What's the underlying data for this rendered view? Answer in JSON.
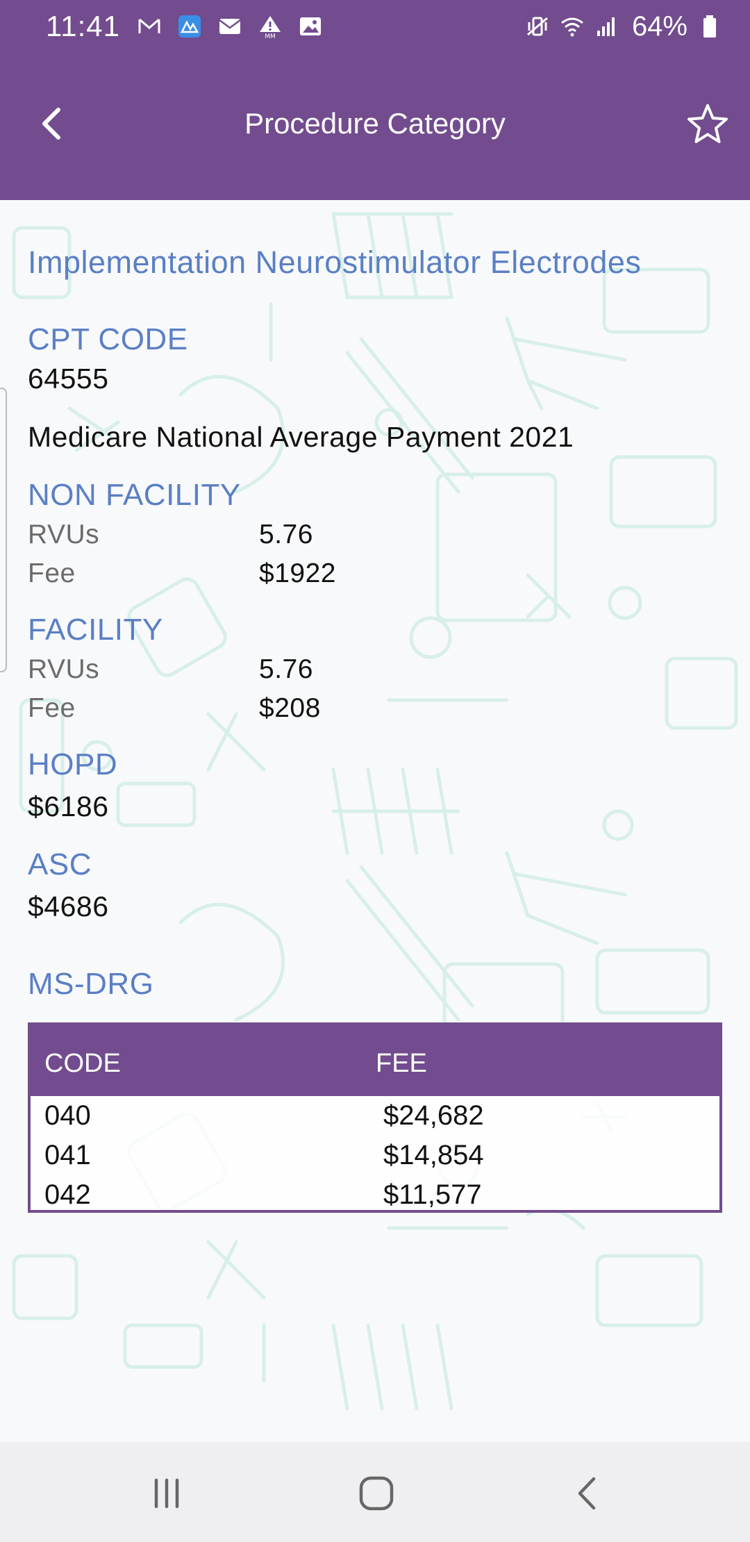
{
  "status_bar": {
    "time": "11:41",
    "battery": "64%",
    "icons_left": [
      "gmail-icon",
      "app-icon",
      "mail-icon",
      "warning-icon",
      "image-icon"
    ],
    "icons_right": [
      "vibrate-icon",
      "wifi-icon",
      "signal-icon",
      "battery-icon"
    ]
  },
  "app_bar": {
    "title": "Procedure Category",
    "background": "#724c8e"
  },
  "procedure": {
    "name": "Implementation Neurostimulator Electrodes",
    "cpt_label": "CPT CODE",
    "cpt_code": "64555",
    "payment_title": "Medicare National Average Payment 2021",
    "non_facility": {
      "label": "NON FACILITY",
      "rvus_label": "RVUs",
      "rvus_value": "5.76",
      "fee_label": "Fee",
      "fee_value": "$1922"
    },
    "facility": {
      "label": "FACILITY",
      "rvus_label": "RVUs",
      "rvus_value": "5.76",
      "fee_label": "Fee",
      "fee_value": "$208"
    },
    "hopd": {
      "label": "HOPD",
      "value": "$6186"
    },
    "asc": {
      "label": "ASC",
      "value": "$4686"
    },
    "ms_drg": {
      "label": "MS-DRG",
      "columns": [
        "CODE",
        "FEE"
      ],
      "rows": [
        {
          "code": "040",
          "fee": "$24,682"
        },
        {
          "code": "041",
          "fee": "$14,854"
        },
        {
          "code": "042",
          "fee": "$11,577"
        }
      ]
    }
  },
  "colors": {
    "accent_purple": "#724c8e",
    "label_blue": "#5a7fc4",
    "pattern_mint": "#bfe8dc"
  }
}
